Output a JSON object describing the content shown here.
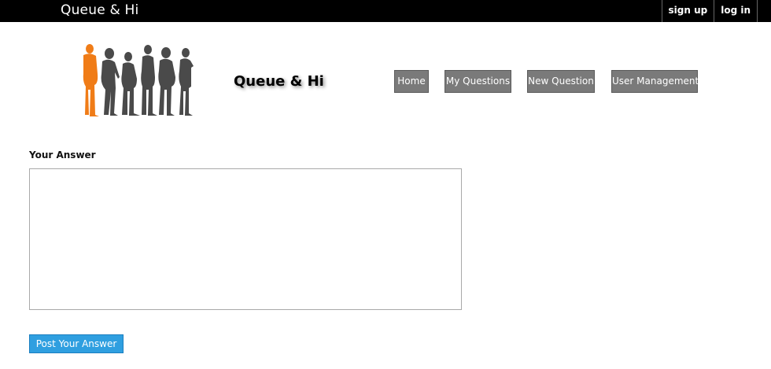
{
  "topbar": {
    "site_name": "Queue & Hi",
    "sign_up": "sign up",
    "log_in": "log in"
  },
  "header": {
    "brand_title": "Queue & Hi",
    "logo_icon": "people-in-queue-silhouette-icon",
    "logo_colors": {
      "first_person": "#f07c17",
      "others": "#4a4a4a"
    }
  },
  "nav": {
    "items": [
      {
        "label": "Home"
      },
      {
        "label": "My Questions"
      },
      {
        "label": "New Question"
      },
      {
        "label": "User Management"
      }
    ]
  },
  "answer": {
    "label": "Your Answer",
    "value": "",
    "submit_label": "Post Your Answer"
  },
  "colors": {
    "topbar_bg": "#000000",
    "nav_bg": "#7a7a7a",
    "primary_button": "#2f9fe0"
  }
}
